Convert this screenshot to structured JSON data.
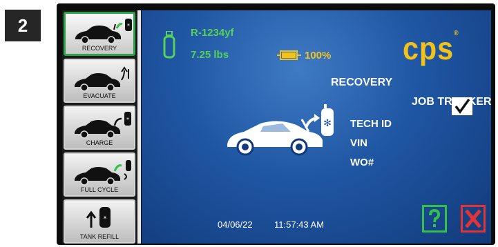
{
  "step": "2",
  "sidebar": {
    "items": [
      {
        "label": "RECOVERY",
        "icon": "car-recovery-icon"
      },
      {
        "label": "EVACUATE",
        "icon": "car-evacuate-icon"
      },
      {
        "label": "CHARGE",
        "icon": "car-charge-icon"
      },
      {
        "label": "FULL CYCLE",
        "icon": "car-full-cycle-icon"
      },
      {
        "label": "TANK REFILL",
        "icon": "tank-refill-icon"
      }
    ]
  },
  "screen": {
    "refrigerant": "R-1234yf",
    "weight": "7.25 lbs",
    "battery_percent": "100%",
    "battery_level": 1.0,
    "mode": "RECOVERY",
    "job_tracker_label": "JOB TRACKER",
    "job_tracker_checked": true,
    "fields": [
      "TECH ID",
      "VIN",
      "WO#"
    ],
    "date": "04/06/22",
    "time": "11:57:43 AM",
    "logo": "cps",
    "logo_mark": "®"
  },
  "colors": {
    "accent_green": "#56d15a",
    "accent_yellow": "#f2c21b",
    "cancel_red": "#e23434",
    "screen_blue": "#1f56a3"
  }
}
